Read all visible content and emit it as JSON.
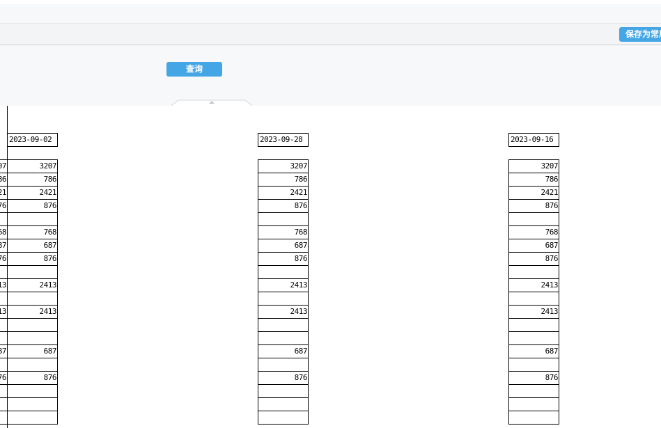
{
  "toolbar": {
    "save_favorite_label": "保存为常用查询"
  },
  "filter": {
    "query_label": "查询"
  },
  "report": {
    "left_partial_values": [
      "207",
      "86",
      "21",
      "76",
      "",
      "68",
      "87",
      "76",
      "",
      "13",
      "",
      "13",
      "",
      "",
      "87",
      "",
      "76",
      "",
      "",
      ""
    ],
    "columns": [
      {
        "date": "2023-09-02",
        "values": [
          "3207",
          "786",
          "2421",
          "876",
          "",
          "768",
          "687",
          "876",
          "",
          "2413",
          "",
          "2413",
          "",
          "",
          "687",
          "",
          "876",
          "",
          "",
          ""
        ]
      },
      {
        "date": "2023-09-28",
        "values": [
          "3207",
          "786",
          "2421",
          "876",
          "",
          "768",
          "687",
          "876",
          "",
          "2413",
          "",
          "2413",
          "",
          "",
          "687",
          "",
          "876",
          "",
          "",
          ""
        ]
      },
      {
        "date": "2023-09-16",
        "values": [
          "3207",
          "786",
          "2421",
          "876",
          "",
          "768",
          "687",
          "876",
          "",
          "2413",
          "",
          "2413",
          "",
          "",
          "687",
          "",
          "876",
          "",
          "",
          ""
        ]
      }
    ]
  }
}
